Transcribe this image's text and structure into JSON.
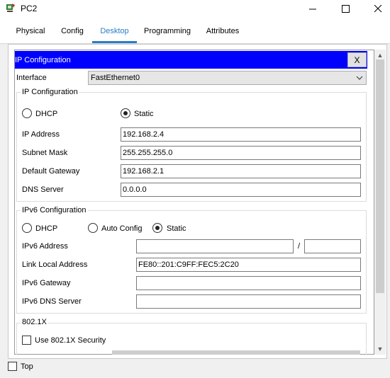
{
  "window": {
    "title": "PC2",
    "minimize": "—",
    "maximize": "☐",
    "close": "✕"
  },
  "tabs": [
    {
      "label": "Physical"
    },
    {
      "label": "Config"
    },
    {
      "label": "Desktop"
    },
    {
      "label": "Programming"
    },
    {
      "label": "Attributes"
    }
  ],
  "active_tab": "Desktop",
  "ip_config": {
    "header": "IP Configuration",
    "close_label": "X",
    "interface_label": "Interface",
    "interface_value": "FastEthernet0",
    "ipv4": {
      "group_title": "IP Configuration",
      "dhcp_label": "DHCP",
      "static_label": "Static",
      "mode": "Static",
      "ip_address_label": "IP Address",
      "ip_address": "192.168.2.4",
      "subnet_mask_label": "Subnet Mask",
      "subnet_mask": "255.255.255.0",
      "default_gateway_label": "Default Gateway",
      "default_gateway": "192.168.2.1",
      "dns_server_label": "DNS Server",
      "dns_server": "0.0.0.0"
    },
    "ipv6": {
      "group_title": "IPv6 Configuration",
      "dhcp_label": "DHCP",
      "auto_config_label": "Auto Config",
      "static_label": "Static",
      "mode": "Static",
      "ipv6_address_label": "IPv6 Address",
      "ipv6_address": "",
      "prefix_separator": "/",
      "prefix_length": "",
      "link_local_label": "Link Local Address",
      "link_local_address": "FE80::201:C9FF:FEC5:2C20",
      "ipv6_gateway_label": "IPv6 Gateway",
      "ipv6_gateway": "",
      "ipv6_dns_label": "IPv6 DNS Server",
      "ipv6_dns": ""
    },
    "dot1x": {
      "group_title": "802.1X",
      "use_security_label": "Use 802.1X Security",
      "use_security_checked": false
    }
  },
  "footer": {
    "top_label": "Top",
    "top_checked": false
  },
  "colors": {
    "header_blue": "#0000ff",
    "tab_active": "#2a7dc7"
  },
  "icons": {
    "app": "packet-tracer-pc-icon",
    "combo": "chevron-down-icon",
    "scroll_up": "scroll-up-arrow-icon",
    "scroll_down": "scroll-down-arrow-icon"
  }
}
